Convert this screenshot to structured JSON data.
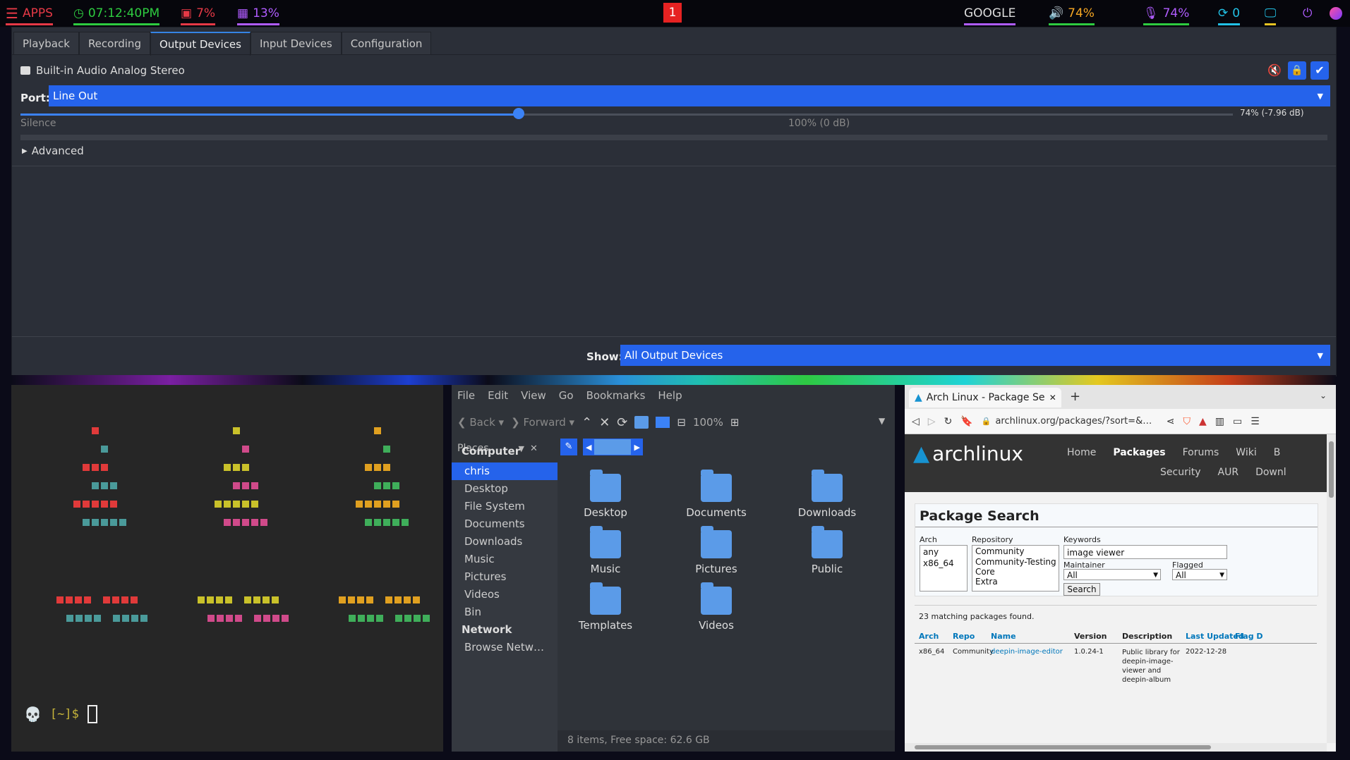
{
  "topbar": {
    "apps": "APPS",
    "clock": "07:12:40PM",
    "cpu": "7%",
    "mem": "13%",
    "workspace": "1",
    "google": "GOOGLE",
    "volume": "74%",
    "mic": "74%",
    "updates": "0",
    "colors": {
      "apps": "#e63946",
      "clock": "#2ecc40",
      "cpu": "#e63946",
      "mem": "#b05cff",
      "vol": "#f5a623",
      "mic": "#b05cff",
      "upd": "#22c1e6"
    }
  },
  "pavucontrol": {
    "tabs": [
      "Playback",
      "Recording",
      "Output Devices",
      "Input Devices",
      "Configuration"
    ],
    "active_tab": "Output Devices",
    "device_name": "Built-in Audio Analog Stereo",
    "port_label": "Port:",
    "port_value": "Line Out",
    "volume_fraction": 0.74,
    "volume_readout": "74% (-7.96 dB)",
    "silence_label": "Silence",
    "hundred_label": "100% (0 dB)",
    "advanced_label": "Advanced",
    "show_label": "Show:",
    "show_value": "All Output Devices"
  },
  "terminal": {
    "prompt": "[~]$"
  },
  "file_manager": {
    "menu": [
      "File",
      "Edit",
      "View",
      "Go",
      "Bookmarks",
      "Help"
    ],
    "back": "Back",
    "forward": "Forward",
    "zoom": "100%",
    "places_label": "Places",
    "sidebar_computer": "Computer",
    "sidebar_items": [
      "chris",
      "Desktop",
      "File System",
      "Documents",
      "Downloads",
      "Music",
      "Pictures",
      "Videos",
      "Bin"
    ],
    "sidebar_network": "Network",
    "sidebar_network_items": [
      "Browse Netw…"
    ],
    "folders": [
      "Desktop",
      "Documents",
      "Downloads",
      "Music",
      "Pictures",
      "Public",
      "Templates",
      "Videos"
    ],
    "status": "8 items, Free space: 62.6 GB"
  },
  "browser": {
    "tab_title": "Arch Linux - Package Search",
    "url": "archlinux.org/packages/?sort=&…",
    "logo_text": "archlinux",
    "nav": [
      "Home",
      "Packages",
      "Forums",
      "Wiki",
      "B",
      "Security",
      "AUR",
      "Downl"
    ],
    "heading": "Package Search",
    "arch_label": "Arch",
    "arch_options": [
      "any",
      "x86_64"
    ],
    "repo_label": "Repository",
    "repo_options": [
      "Community",
      "Community-Testing",
      "Core",
      "Extra"
    ],
    "keywords_label": "Keywords",
    "keywords_value": "image viewer",
    "maintainer_label": "Maintainer",
    "maintainer_value": "All",
    "flagged_label": "Flagged",
    "flagged_value": "All",
    "search_button": "Search",
    "results_count": "23 matching packages found.",
    "columns": [
      "Arch",
      "Repo",
      "Name",
      "Version",
      "Description",
      "Last Updated",
      "Flag D"
    ],
    "rows": [
      {
        "arch": "x86_64",
        "repo": "Community",
        "name": "deepin-image-editor",
        "version": "1.0.24-1",
        "description": "Public library for deepin-image-viewer and deepin-album",
        "updated": "2022-12-28"
      }
    ]
  }
}
